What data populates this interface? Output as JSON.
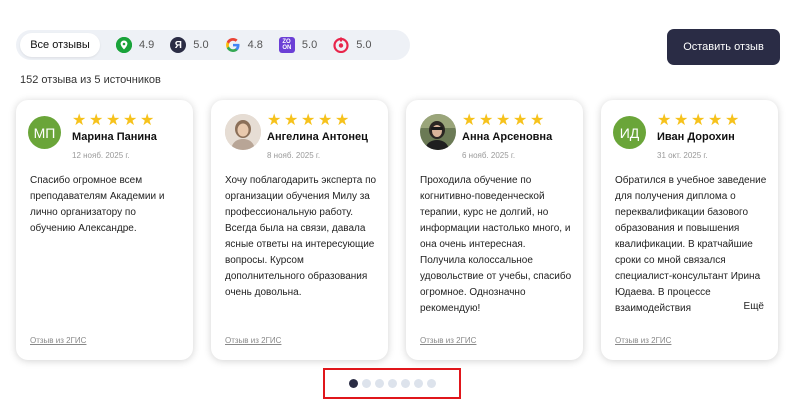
{
  "tabs": {
    "all_label": "Все отзывы",
    "sources": [
      {
        "icon": "2gis-icon",
        "rating": "4.9",
        "color": "#19a33a"
      },
      {
        "icon": "yandex-icon",
        "rating": "5.0",
        "color": "#2b2d45"
      },
      {
        "icon": "google-icon",
        "rating": "4.8",
        "color": "#4285f4"
      },
      {
        "icon": "zoon-icon",
        "rating": "5.0",
        "color": "#6b3fd6"
      },
      {
        "icon": "flamp-icon",
        "rating": "5.0",
        "color": "#e8254b"
      }
    ]
  },
  "cta_label": "Оставить отзыв",
  "summary": "152 отзыва из 5 источников",
  "reviews": [
    {
      "initials": "МП",
      "avatar_color": "#6aa539",
      "name": "Марина Панина",
      "date": "12 нояб. 2025 г.",
      "text": "Спасибо огромное всем преподавателям Академии и лично организатору по обучению Александре.",
      "source": "Отзыв из 2ГИС"
    },
    {
      "initials": "",
      "avatar_color": "#c9b8a8",
      "name": "Ангелина Антонец",
      "date": "8 нояб. 2025 г.",
      "text": "Хочу поблагодарить эксперта по организации обучения Милу за профессиональную работу. Всегда была на связи, давала ясные ответы на интересующие вопросы. Курсом дополнительного образования очень довольна.",
      "source": "Отзыв из 2ГИС"
    },
    {
      "initials": "",
      "avatar_color": "#4a4a3f",
      "name": "Анна Арсеновна",
      "date": "6 нояб. 2025 г.",
      "text": "Проходила обучение по когнитивно-поведенческой терапии, курс не долгий, но информации настолько много, и она очень интересная. Получила колоссальное удовольствие от учебы, спасибо огромное. Однозначно рекомендую!",
      "source": "Отзыв из 2ГИС"
    },
    {
      "initials": "ИД",
      "avatar_color": "#6aa539",
      "name": "Иван Дорохин",
      "date": "31 окт. 2025 г.",
      "text": "Обратился в учебное заведение для получения диплома о переквалификации базового образования и повышения квалификации. В кратчайшие сроки со мной связался специалист-консультант Ирина Юдаева. В процессе взаимодействия",
      "more": "Ещё",
      "source": "Отзыв из 2ГИС"
    }
  ],
  "pagination": {
    "pages": 7,
    "active": 1
  }
}
